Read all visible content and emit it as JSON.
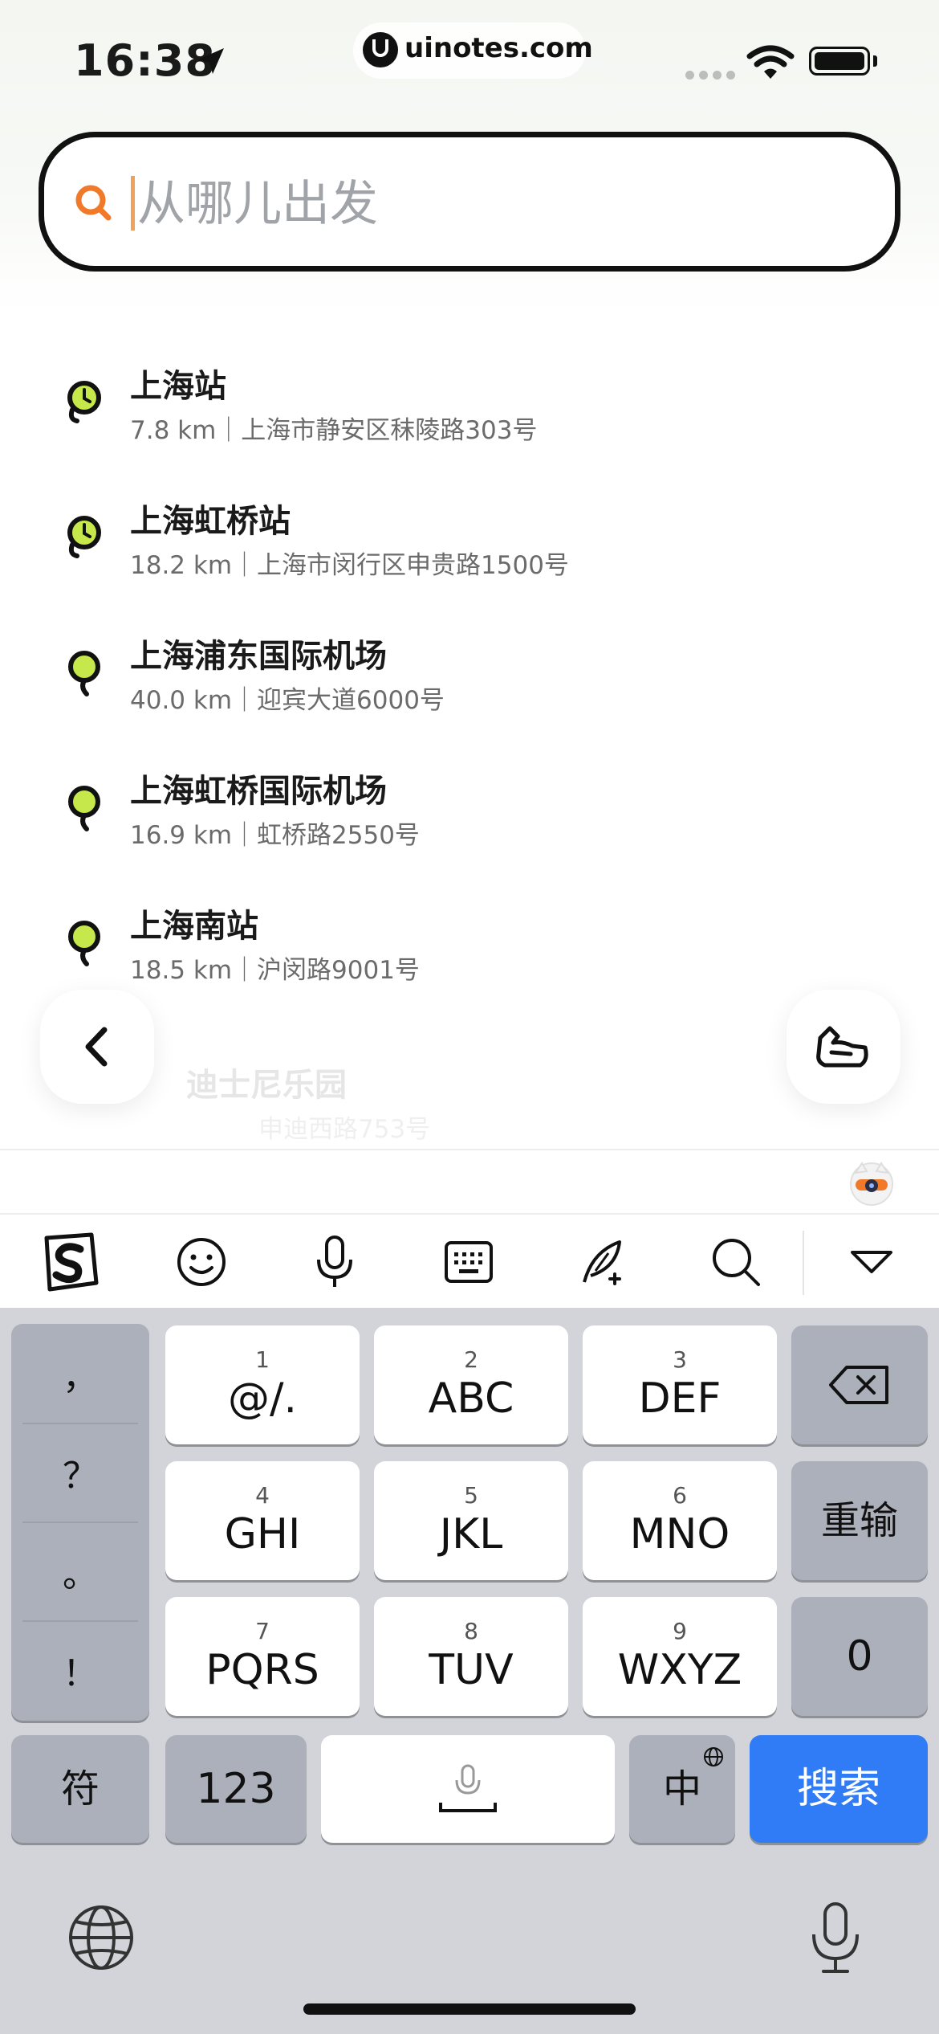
{
  "status_bar": {
    "time": "16:38",
    "url": "uinotes.com"
  },
  "search": {
    "placeholder": "从哪儿出发",
    "value": ""
  },
  "places": [
    {
      "name": "上海站",
      "detail": "7.8 km｜上海市静安区秣陵路303号",
      "icon": "history-pin-icon"
    },
    {
      "name": "上海虹桥站",
      "detail": "18.2 km｜上海市闵行区申贵路1500号",
      "icon": "history-pin-icon"
    },
    {
      "name": "上海浦东国际机场",
      "detail": "40.0 km｜迎宾大道6000号",
      "icon": "location-pin-icon"
    },
    {
      "name": "上海虹桥国际机场",
      "detail": "16.9 km｜虹桥路2550号",
      "icon": "location-pin-icon"
    },
    {
      "name": "上海南站",
      "detail": "18.5 km｜沪闵路9001号",
      "icon": "location-pin-icon"
    }
  ],
  "ghost_place": {
    "name": "迪士尼乐园",
    "detail": "申迪西路753号"
  },
  "keyboard": {
    "punctuation": [
      "，",
      "？",
      "。",
      "！"
    ],
    "keys": [
      {
        "num": "1",
        "label": "@/."
      },
      {
        "num": "2",
        "label": "ABC"
      },
      {
        "num": "3",
        "label": "DEF"
      },
      {
        "num": "4",
        "label": "GHI"
      },
      {
        "num": "5",
        "label": "JKL"
      },
      {
        "num": "6",
        "label": "MNO"
      },
      {
        "num": "7",
        "label": "PQRS"
      },
      {
        "num": "8",
        "label": "TUV"
      },
      {
        "num": "9",
        "label": "WXYZ"
      }
    ],
    "retype": "重输",
    "zero": "0",
    "symbols": "符",
    "numbers": "123",
    "language": "中",
    "search": "搜索"
  },
  "colors": {
    "accent": "#f0a25a",
    "search_key": "#2f7cf6",
    "pin_green": "#c6e84a"
  }
}
